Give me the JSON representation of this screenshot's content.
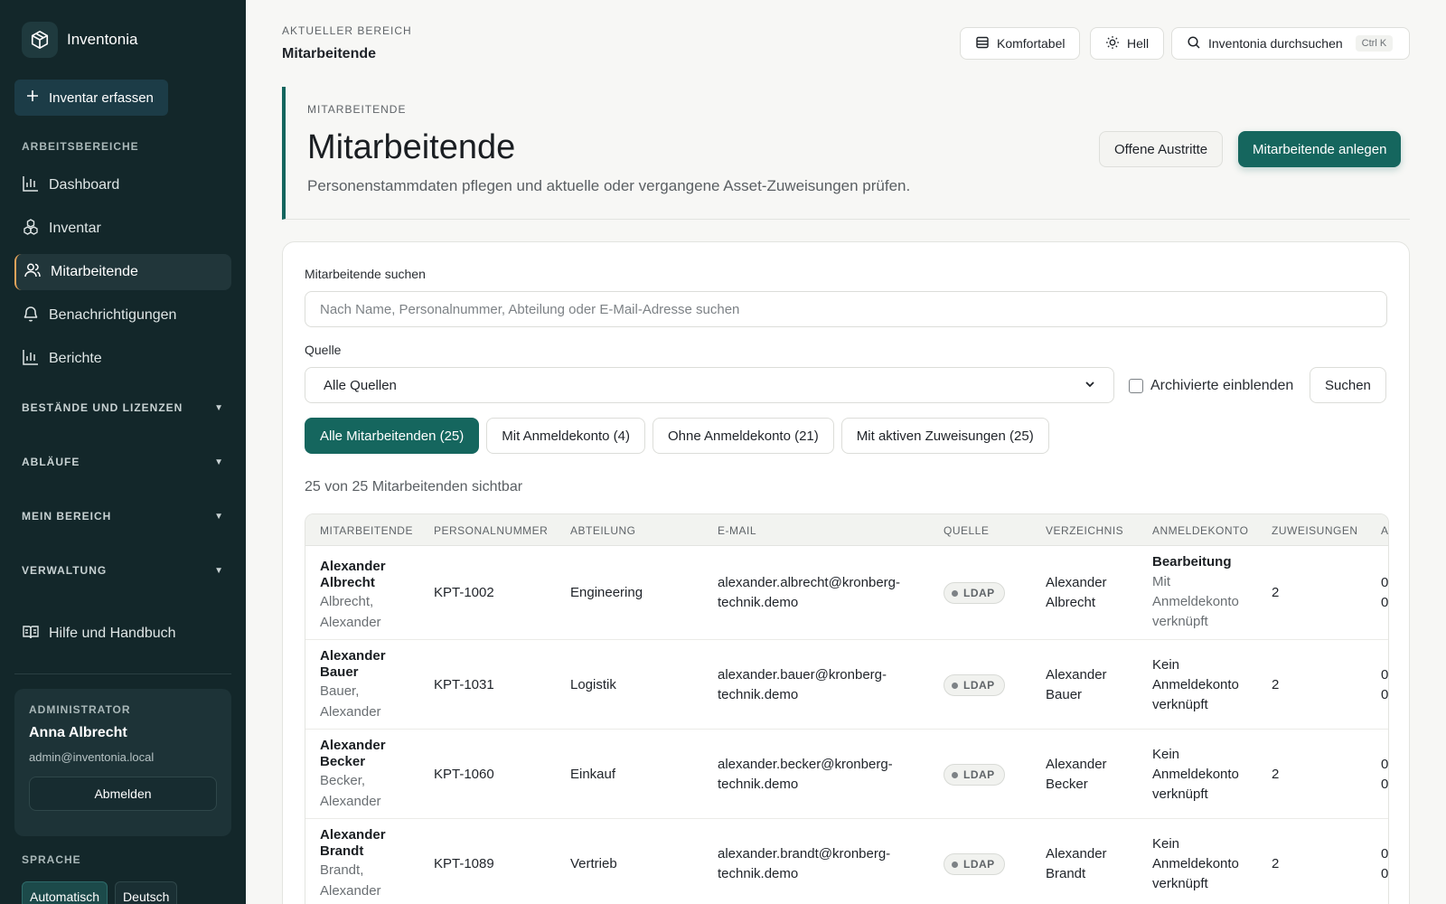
{
  "sidebar": {
    "brand": "Inventonia",
    "create_button": "Inventar erfassen",
    "section_workspaces": "ARBEITSBEREICHE",
    "nav": [
      {
        "label": "Dashboard",
        "icon": "bar-chart-icon"
      },
      {
        "label": "Inventar",
        "icon": "boxes-icon"
      },
      {
        "label": "Mitarbeitende",
        "icon": "users-icon",
        "active": true
      },
      {
        "label": "Benachrichtigungen",
        "icon": "bell-icon"
      },
      {
        "label": "Berichte",
        "icon": "bar-chart-icon"
      }
    ],
    "groups": [
      "BESTÄNDE UND LIZENZEN",
      "ABLÄUFE",
      "MEIN BEREICH",
      "VERWALTUNG"
    ],
    "help": "Hilfe und Handbuch",
    "admin": {
      "role": "ADMINISTRATOR",
      "name": "Anna Albrecht",
      "email": "admin@inventonia.local",
      "logout": "Abmelden"
    },
    "language_label": "SPRACHE",
    "languages": [
      "Automatisch",
      "Deutsch"
    ]
  },
  "topbar": {
    "crumb_label": "AKTUELLER BEREICH",
    "crumb_title": "Mitarbeitende",
    "density": "Komfortabel",
    "theme": "Hell",
    "search": "Inventonia durchsuchen",
    "shortcut": "Ctrl K"
  },
  "header": {
    "eyebrow": "MITARBEITENDE",
    "title": "Mitarbeitende",
    "subtitle": "Personenstammdaten pflegen und aktuelle oder vergangene Asset-Zuweisungen prüfen.",
    "secondary_button": "Offene Austritte",
    "primary_button": "Mitarbeitende anlegen"
  },
  "filters": {
    "search_label": "Mitarbeitende suchen",
    "search_placeholder": "Nach Name, Personalnummer, Abteilung oder E-Mail-Adresse suchen",
    "source_label": "Quelle",
    "source_value": "Alle Quellen",
    "archived_label": "Archivierte einblenden",
    "search_button": "Suchen",
    "chips": [
      {
        "label": "Alle Mitarbeitenden (25)",
        "active": true
      },
      {
        "label": "Mit Anmeldekonto (4)",
        "active": false
      },
      {
        "label": "Ohne Anmeldekonto (21)",
        "active": false
      },
      {
        "label": "Mit aktiven Zuweisungen (25)",
        "active": false
      }
    ],
    "count_text": "25 von 25 Mitarbeitenden sichtbar"
  },
  "table": {
    "headers": [
      "MITARBEITENDE",
      "PERSONALNUMMER",
      "ABTEILUNG",
      "E-MAIL",
      "QUELLE",
      "VERZEICHNIS",
      "ANMELDEKONTO",
      "ZUWEISUNGEN",
      "A"
    ],
    "rows": [
      {
        "first": "Alexander",
        "last": "Albrecht",
        "sub1": "Albrecht,",
        "sub2": "Alexander",
        "number": "KPT-1002",
        "department": "Engineering",
        "email1": "alexander.albrecht@kronberg-",
        "email2": "technik.demo",
        "source": "LDAP",
        "dir1": "Alexander",
        "dir2": "Albrecht",
        "acct_title": "Bearbeitung",
        "acct1": "Mit",
        "acct2": "Anmeldekonto",
        "acct3": "verknüpft",
        "assignments": "2",
        "extra1": "0",
        "extra2": "0"
      },
      {
        "first": "Alexander",
        "last": "Bauer",
        "sub1": "Bauer,",
        "sub2": "Alexander",
        "number": "KPT-1031",
        "department": "Logistik",
        "email1": "alexander.bauer@kronberg-",
        "email2": "technik.demo",
        "source": "LDAP",
        "dir1": "Alexander",
        "dir2": "Bauer",
        "acct1": "Kein",
        "acct2": "Anmeldekonto",
        "acct3": "verknüpft",
        "assignments": "2",
        "extra1": "0",
        "extra2": "0"
      },
      {
        "first": "Alexander",
        "last": "Becker",
        "sub1": "Becker,",
        "sub2": "Alexander",
        "number": "KPT-1060",
        "department": "Einkauf",
        "email1": "alexander.becker@kronberg-",
        "email2": "technik.demo",
        "source": "LDAP",
        "dir1": "Alexander",
        "dir2": "Becker",
        "acct1": "Kein",
        "acct2": "Anmeldekonto",
        "acct3": "verknüpft",
        "assignments": "2",
        "extra1": "0",
        "extra2": "0"
      },
      {
        "first": "Alexander",
        "last": "Brandt",
        "sub1": "Brandt,",
        "sub2": "Alexander",
        "number": "KPT-1089",
        "department": "Vertrieb",
        "email1": "alexander.brandt@kronberg-",
        "email2": "technik.demo",
        "source": "LDAP",
        "dir1": "Alexander",
        "dir2": "Brandt",
        "acct1": "Kein",
        "acct2": "Anmeldekonto",
        "acct3": "verknüpft",
        "assignments": "2",
        "extra1": "0",
        "extra2": "0"
      }
    ]
  },
  "colors": {
    "sidebar_bg": "#13272a",
    "accent": "#15665e",
    "active_marker": "#e6a45a"
  }
}
